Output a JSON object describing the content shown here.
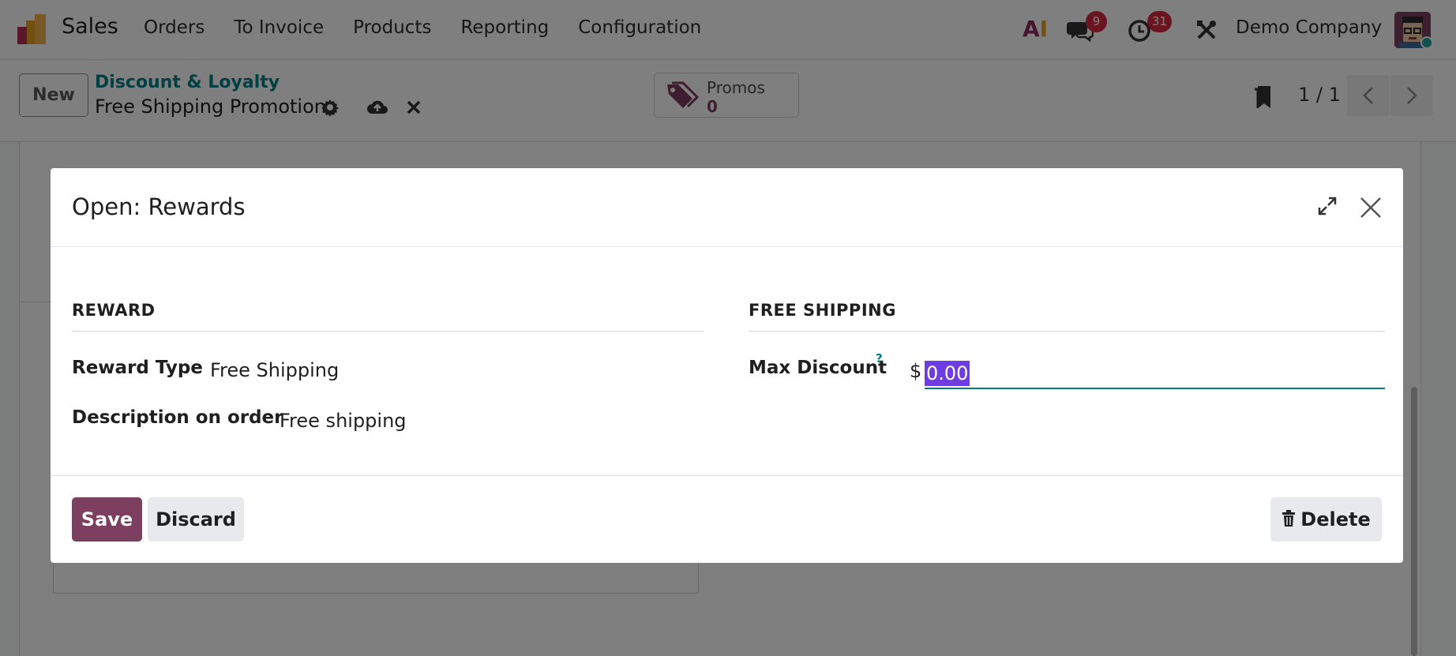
{
  "navbar": {
    "app_name": "Sales",
    "menu": [
      "Orders",
      "To Invoice",
      "Products",
      "Reporting",
      "Configuration"
    ],
    "ai_label_a": "A",
    "ai_label_i": "I",
    "messages_badge": "9",
    "activities_badge": "31",
    "company": "Demo Company"
  },
  "control": {
    "new_label": "New",
    "breadcrumb_parent": "Discount & Loyalty",
    "breadcrumb_current": "Free Shipping Promotion",
    "smart_button_label": "Promos",
    "smart_button_count": "0",
    "pager": "1 / 1"
  },
  "modal": {
    "title": "Open: Rewards",
    "reward_group_title": "REWARD",
    "reward_type_label": "Reward Type",
    "reward_type_value": "Free Shipping",
    "description_label": "Description on order",
    "description_value": "Free shipping",
    "shipping_group_title": "FREE SHIPPING",
    "max_discount_label": "Max Discount",
    "help_mark": "?",
    "currency_symbol": "$",
    "max_discount_value": "0.00",
    "save_label": "Save",
    "discard_label": "Discard",
    "delete_label": "Delete"
  },
  "colors": {
    "brand": "#7c3f60",
    "accent": "#017e84",
    "badge": "#d2283e",
    "selection": "#6f3ce3"
  },
  "icons": [
    "app-logo-icon",
    "chat-icon",
    "clock-icon",
    "tools-icon",
    "gear-icon",
    "cloud-upload-icon",
    "close-icon",
    "tags-icon",
    "bookmark-icon",
    "chevron-left-icon",
    "chevron-right-icon",
    "expand-icon",
    "trash-icon"
  ]
}
